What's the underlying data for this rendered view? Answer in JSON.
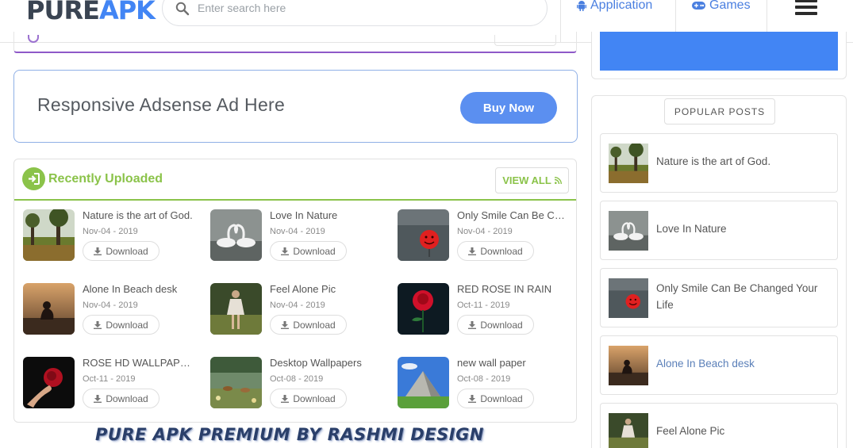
{
  "header": {
    "logo_part1": "PURE",
    "logo_part2": "APK",
    "search_placeholder": "Enter search here",
    "search_icon": "search-icon",
    "nav": [
      {
        "label": "Application",
        "icon": "android-icon"
      },
      {
        "label": "Games",
        "icon": "gamepad-icon"
      }
    ],
    "menu_icon": "hamburger-menu-icon"
  },
  "ad": {
    "text": "Responsive Adsense Ad Here",
    "button": "Buy Now"
  },
  "recent": {
    "title": "Recently Uploaded",
    "view_all": "VIEW ALL",
    "download_label": "Download",
    "items": [
      {
        "title": "Nature is the art of God.",
        "date": "Nov-04 - 2019",
        "thumb": "nature"
      },
      {
        "title": "Love In Nature",
        "date": "Nov-04 - 2019",
        "thumb": "swans"
      },
      {
        "title": "Only Smile Can Be Changed Your Life",
        "date": "Nov-04 - 2019",
        "thumb": "smile"
      },
      {
        "title": "Alone In Beach desk",
        "date": "Nov-04 - 2019",
        "thumb": "beach"
      },
      {
        "title": "Feel Alone Pic",
        "date": "Nov-04 - 2019",
        "thumb": "girl"
      },
      {
        "title": "RED ROSE IN RAIN",
        "date": "Oct-11 - 2019",
        "thumb": "rose-rain"
      },
      {
        "title": "ROSE HD WALLPAPER",
        "date": "Oct-11 - 2019",
        "thumb": "rose-hand"
      },
      {
        "title": "Desktop Wallpapers",
        "date": "Oct-08 - 2019",
        "thumb": "deer"
      },
      {
        "title": "new wall paper",
        "date": "Oct-08 - 2019",
        "thumb": "pyramid"
      }
    ]
  },
  "popular": {
    "title": "POPULAR POSTS",
    "items": [
      {
        "title": "Nature is the art of God.",
        "thumb": "nature"
      },
      {
        "title": "Love In Nature",
        "thumb": "swans"
      },
      {
        "title": "Only Smile Can Be Changed Your Life",
        "thumb": "smile"
      },
      {
        "title": "Alone In Beach desk",
        "thumb": "beach"
      },
      {
        "title": "Feel Alone Pic",
        "thumb": "girl"
      }
    ]
  },
  "watermark": "PURE APK PREMIUM BY RASHMI DESIGN",
  "colors": {
    "brand_blue": "#4285f4",
    "accent_green": "#8bc34a",
    "accent_purple": "#8e59c8",
    "link_blue": "#4a7fe0"
  }
}
